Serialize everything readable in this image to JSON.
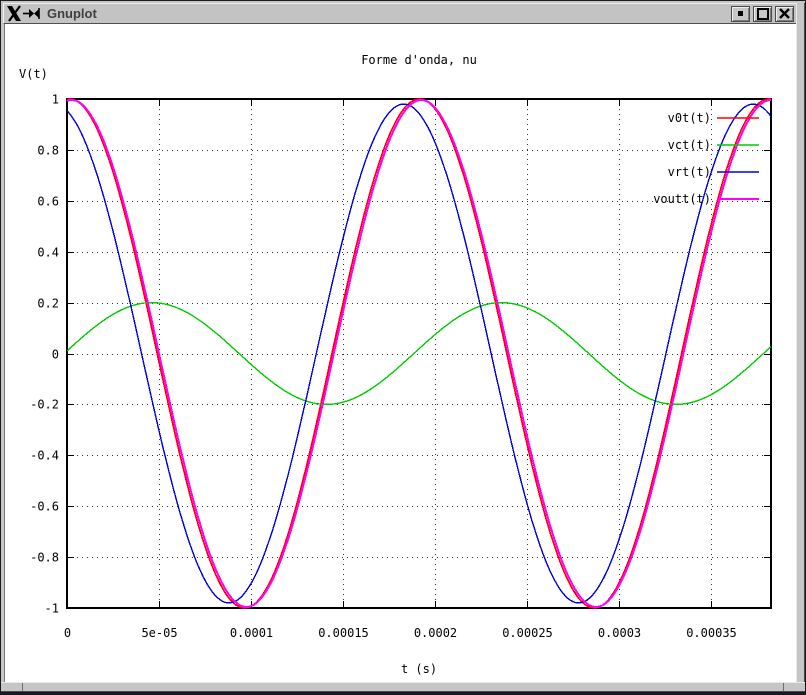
{
  "window": {
    "title": "Gnuplot",
    "icons": {
      "logo": "x11-logo",
      "pin": "window-pin",
      "minimize": "filled-square",
      "maximize": "outlined-square",
      "close": "cross"
    }
  },
  "chart_data": {
    "type": "line",
    "title": "Forme d'onda, nu",
    "xlabel": "t (s)",
    "ylabel": "V(t)",
    "xlim": [
      0,
      0.0003826
    ],
    "ylim": [
      -1,
      1
    ],
    "grid": true,
    "grid_style": "dotted",
    "legend_position": "inside-top-right",
    "xticks": [
      {
        "label": "0",
        "value": 0
      },
      {
        "label": "5e-05",
        "value": 5e-05
      },
      {
        "label": "0.0001",
        "value": 0.0001
      },
      {
        "label": "0.00015",
        "value": 0.00015
      },
      {
        "label": "0.0002",
        "value": 0.0002
      },
      {
        "label": "0.00025",
        "value": 0.00025
      },
      {
        "label": "0.0003",
        "value": 0.0003
      },
      {
        "label": "0.00035",
        "value": 0.00035
      }
    ],
    "yticks": [
      {
        "label": "1",
        "value": 1
      },
      {
        "label": "0.8",
        "value": 0.8
      },
      {
        "label": "0.6",
        "value": 0.6
      },
      {
        "label": "0.4",
        "value": 0.4
      },
      {
        "label": "0.2",
        "value": 0.2
      },
      {
        "label": "0",
        "value": 0
      },
      {
        "label": "-0.2",
        "value": -0.2
      },
      {
        "label": "-0.4",
        "value": -0.4
      },
      {
        "label": "-0.6",
        "value": -0.6
      },
      {
        "label": "-0.8",
        "value": -0.8
      },
      {
        "label": "-1",
        "value": -1
      }
    ],
    "series": [
      {
        "name": "v0t(t)",
        "color": "#ff0000",
        "stroke_width": 1.6,
        "waveform": "cosine",
        "amplitude": 1.0,
        "period_s": 0.00019,
        "peak_time_s": 0.0001915
      },
      {
        "name": "vct(t)",
        "color": "#00cc00",
        "stroke_width": 1.4,
        "waveform": "cosine",
        "amplitude": 0.2,
        "period_s": 0.00019,
        "peak_time_s": 4.6e-05
      },
      {
        "name": "vrt(t)",
        "color": "#0000e0",
        "stroke_width": 1.4,
        "waveform": "cosine",
        "amplitude": 0.98,
        "period_s": 0.00019,
        "peak_time_s": 0.000183
      },
      {
        "name": "voutt(t)",
        "color": "#ff00ff",
        "stroke_width": 2.0,
        "waveform": "cosine",
        "amplitude": 0.996,
        "period_s": 0.00019,
        "peak_time_s": 0.0001925
      }
    ]
  }
}
